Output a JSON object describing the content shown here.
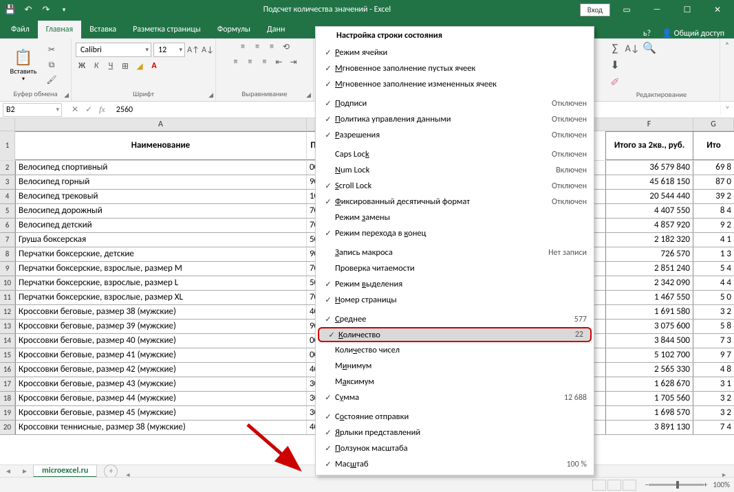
{
  "title": "Подсчет количества значений  -  Excel",
  "titlebar": {
    "login": "Вход"
  },
  "tabs": {
    "file": "Файл",
    "home": "Главная",
    "insert": "Вставка",
    "layout": "Разметка страницы",
    "formulas": "Формулы",
    "data": "Данн",
    "tell": "ь?",
    "share": "Общий доступ"
  },
  "ribbon": {
    "paste": "Вставить",
    "clipboard": "Буфер обмена",
    "font_name": "Calibri",
    "font_size": "12",
    "font_group": "Шрифт",
    "align_group": "Выравнивание",
    "edit_group": "Редактирование"
  },
  "fbar": {
    "name": "B2",
    "value": "2560"
  },
  "cols": {
    "A": "A",
    "F": "F",
    "G": "G"
  },
  "header_row": {
    "A": "Наименование",
    "B": "П",
    "F": "Итого за 2кв., руб.",
    "G": "Ито"
  },
  "rows": [
    {
      "n": "2",
      "A": "Велосипед спортивный",
      "B": "00",
      "F": "36 579 840",
      "G": "69 8"
    },
    {
      "n": "3",
      "A": "Велосипед горный",
      "B": "90",
      "F": "45 618 150",
      "G": "87 0"
    },
    {
      "n": "4",
      "A": "Велосипед трековый",
      "B": "10",
      "F": "20 544 440",
      "G": "39 2"
    },
    {
      "n": "5",
      "A": "Велосипед дорожный",
      "B": "70",
      "F": "4 407 550",
      "G": "8 4"
    },
    {
      "n": "6",
      "A": "Велосипед детский",
      "B": "70",
      "F": "4 857 920",
      "G": "9 2"
    },
    {
      "n": "7",
      "A": "Груша боксерская",
      "B": "50",
      "F": "2 182 320",
      "G": "4 1"
    },
    {
      "n": "8",
      "A": "Перчатки боксерские, детские",
      "B": "90",
      "F": "726 570",
      "G": "1 3"
    },
    {
      "n": "9",
      "A": "Перчатки боксерские, взрослые, размер M",
      "B": "70",
      "F": "2 851 240",
      "G": "5 4"
    },
    {
      "n": "10",
      "A": "Перчатки боксерские, взрослые, размер L",
      "B": "50",
      "F": "2 342 090",
      "G": "4 4"
    },
    {
      "n": "11",
      "A": "Перчатки боксерские, взрослые, размер XL",
      "B": "70",
      "F": "1 467 550",
      "G": "5 0"
    },
    {
      "n": "12",
      "A": "Кроссовки беговые, размер 38 (мужские)",
      "B": "40",
      "F": "1 691 580",
      "G": "3 2"
    },
    {
      "n": "13",
      "A": "Кроссовки беговые, размер 39 (мужские)",
      "B": "90",
      "F": "3 075 600",
      "G": "5 8"
    },
    {
      "n": "14",
      "A": "Кроссовки беговые, размер 40 (мужские)",
      "B": "00",
      "F": "3 844 500",
      "G": "7 3"
    },
    {
      "n": "15",
      "A": "Кроссовки беговые, размер 41 (мужские)",
      "B": "00",
      "F": "5 102 700",
      "G": "9 7"
    },
    {
      "n": "16",
      "A": "Кроссовки беговые, размер 42 (мужские)",
      "B": "40",
      "F": "2 565 330",
      "G": "4 8"
    },
    {
      "n": "17",
      "A": "Кроссовки беговые, размер 43 (мужские)",
      "B": "30",
      "F": "1 628 670",
      "G": "3 1"
    },
    {
      "n": "18",
      "A": "Кроссовки беговые, размер 44 (мужские)",
      "B": "30",
      "F": "1 705 560",
      "G": "3 2"
    },
    {
      "n": "19",
      "A": "Кроссовки беговые, размер 45 (мужские)",
      "B": "30",
      "F": "1 698 570",
      "G": "3 2"
    },
    {
      "n": "20",
      "A": "Кроссовки теннисные, размер 38 (мужские)",
      "B": "40",
      "F": "3 891 130",
      "G": "7 4"
    }
  ],
  "sheet_tab": "microexcel.ru",
  "statusbar": {
    "zoom": "100%"
  },
  "ctx": {
    "title": "Настройка строки состояния",
    "items": [
      {
        "chk": true,
        "lbl": "Режим ячейки",
        "u": "Р"
      },
      {
        "chk": true,
        "lbl": "Мгновенное заполнение пустых ячеек",
        "u": "М"
      },
      {
        "chk": true,
        "lbl": "Мгновенное заполнение измененных ячеек",
        "u": "М"
      },
      {
        "sep": true
      },
      {
        "chk": true,
        "lbl": "Подписи",
        "u": "П",
        "val": "Отключен"
      },
      {
        "chk": true,
        "lbl": "Политика управления данными",
        "u": "П",
        "val": "Отключен"
      },
      {
        "chk": true,
        "lbl": "Разрешения",
        "u": "Р",
        "val": "Отключен"
      },
      {
        "sep": true
      },
      {
        "chk": false,
        "lbl": "Caps Lock",
        "u": "k",
        "val": "Отключен"
      },
      {
        "chk": false,
        "lbl": "Num Lock",
        "u": "N",
        "val": "Включен"
      },
      {
        "chk": true,
        "lbl": "Scroll Lock",
        "u": "S",
        "val": "Отключен"
      },
      {
        "chk": true,
        "lbl": "Фиксированный десятичный формат",
        "u": "Ф",
        "val": "Отключен"
      },
      {
        "chk": false,
        "lbl": "Режим замены",
        "u": "з"
      },
      {
        "chk": true,
        "lbl": "Режим перехода в конец",
        "u": "к"
      },
      {
        "sep": true
      },
      {
        "chk": false,
        "lbl": "Запись макроса",
        "u": "З",
        "val": "Нет записи"
      },
      {
        "chk": false,
        "lbl": "Проверка читаемости"
      },
      {
        "chk": true,
        "lbl": "Режим выделения",
        "u": "в"
      },
      {
        "chk": true,
        "lbl": "Номер страницы",
        "u": "Н"
      },
      {
        "sep": true
      },
      {
        "chk": true,
        "lbl": "Среднее",
        "u": "С",
        "val": "577"
      },
      {
        "chk": true,
        "lbl": "Количество",
        "u": "К",
        "val": "22",
        "hl": true
      },
      {
        "chk": false,
        "lbl": "Количество чисел",
        "u": "ч"
      },
      {
        "chk": false,
        "lbl": "Минимум",
        "u": "и"
      },
      {
        "chk": false,
        "lbl": "Максимум",
        "u": "а"
      },
      {
        "chk": true,
        "lbl": "Сумма",
        "u": "у",
        "val": "12 688"
      },
      {
        "sep": true
      },
      {
        "chk": true,
        "lbl": "Состояние отправки",
        "u": "о"
      },
      {
        "chk": true,
        "lbl": "Ярлыки представлений",
        "u": "Я"
      },
      {
        "chk": true,
        "lbl": "Ползунок масштаба",
        "u": "П"
      },
      {
        "chk": true,
        "lbl": "Масштаб",
        "u": "ш",
        "val": "100 %"
      }
    ]
  }
}
